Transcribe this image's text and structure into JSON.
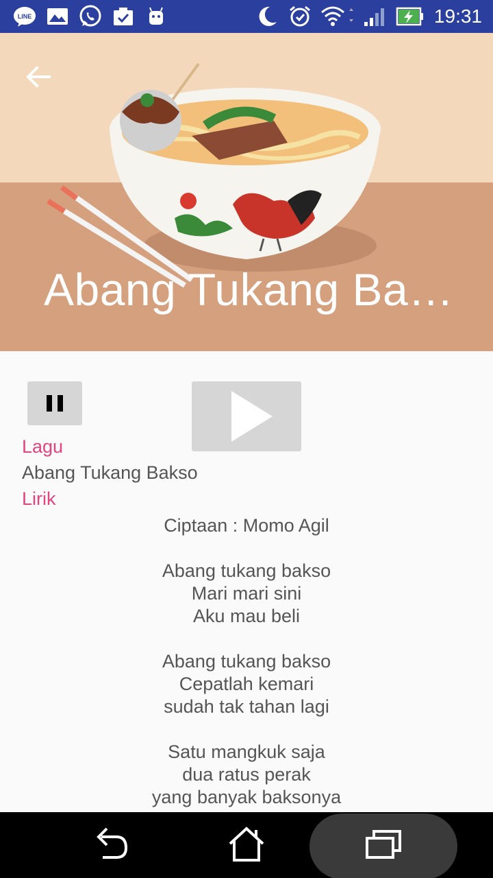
{
  "status_bar": {
    "time": "19:31",
    "icons": [
      "line-icon",
      "gallery-icon",
      "whatsapp-icon",
      "clipboard-check-icon",
      "android-icon",
      "moon-icon",
      "alarm-icon",
      "wifi-icon",
      "signal-icon",
      "battery-charging-icon"
    ]
  },
  "header": {
    "title": "Abang Tukang Bakso",
    "back_icon": "arrow-back-icon"
  },
  "player": {
    "pause_icon": "pause-icon",
    "play_icon": "play-icon"
  },
  "song": {
    "lagu_label": "Lagu",
    "name": "Abang Tukang Bakso",
    "lirik_label": "Lirik",
    "lyrics": [
      "Ciptaan : Momo Agil",
      "",
      "Abang tukang bakso",
      "Mari mari sini",
      "Aku mau beli",
      "",
      "Abang tukang bakso",
      "Cepatlah kemari",
      " sudah tak tahan lagi",
      "",
      "Satu mangkuk saja",
      "dua ratus perak",
      "yang banyak baksonya"
    ]
  },
  "nav_bar": {
    "icons": [
      "nav-back-icon",
      "nav-home-icon",
      "nav-recents-icon"
    ]
  },
  "colors": {
    "status_bar": "#2a3f9e",
    "accent_pink": "#e2457d",
    "header_bg": "#f3d8bc",
    "table_bg": "#d4a07e"
  }
}
